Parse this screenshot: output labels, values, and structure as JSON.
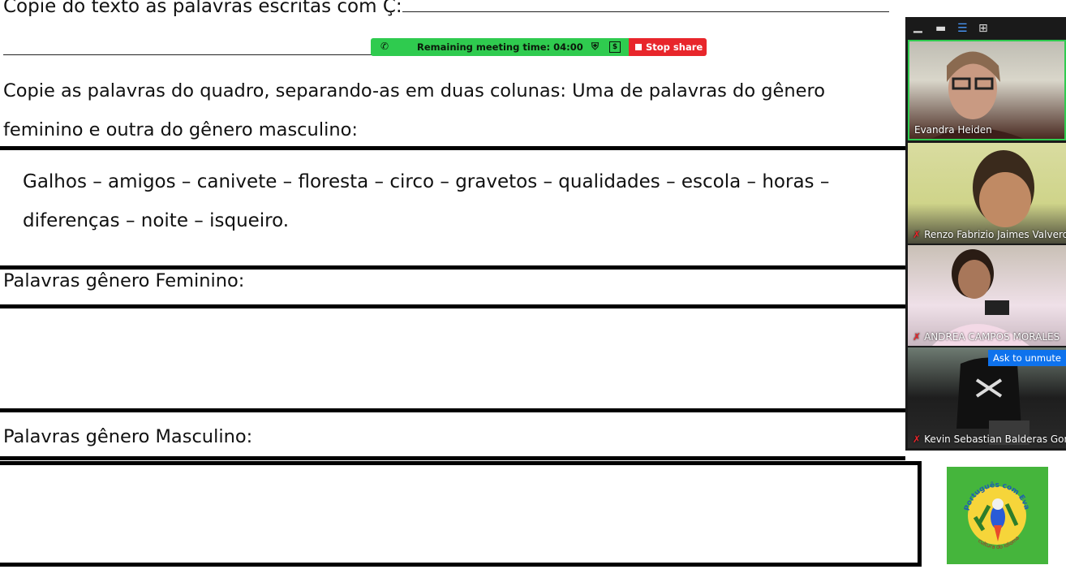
{
  "document": {
    "line1": "Copie do texto as palavras escritas com Ç:",
    "instruction": "Copie as palavras do quadro, separando-as em duas colunas: Uma de palavras do gênero feminino e outra do gênero masculino:",
    "word_box": "Galhos – amigos – canivete – floresta – circo – gravetos – qualidades – escola – horas – diferenças – noite – isqueiro.",
    "label_feminine": "Palavras gênero Feminino:",
    "label_masculine": "Palavras gênero Masculino:"
  },
  "meeting_bar": {
    "remaining_time": "Remaining meeting time: 04:00",
    "stop_share": "Stop share"
  },
  "video_panel": {
    "participants": [
      {
        "name": "Evandra Heiden",
        "muted": false,
        "active_speaker": true
      },
      {
        "name": "Renzo Fabrizio Jaimes Valverde",
        "muted": true
      },
      {
        "name": "ANDREA CAMPOS MORALES",
        "muted": true
      },
      {
        "name": "Kevin Sebastian Balderas Gonzalez",
        "muted": true
      }
    ],
    "ask_to_unmute": "Ask to unmute"
  },
  "logo": {
    "text_top": "Português com Eva",
    "text_bottom": "cultura do idioma",
    "background": "#45b53c"
  },
  "colors": {
    "meeting_green": "#2fcb4f",
    "stop_red": "#e8262b",
    "ask_blue": "#0e72ed"
  }
}
